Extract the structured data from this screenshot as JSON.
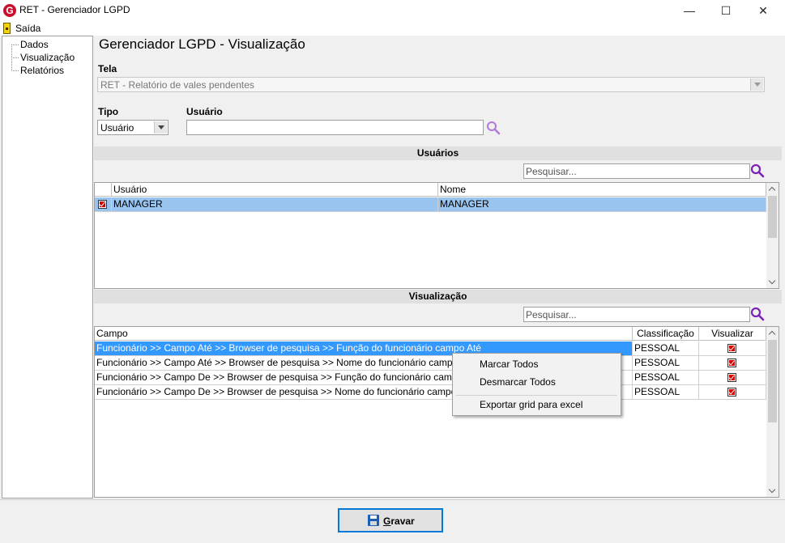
{
  "window": {
    "app_icon": "G",
    "title": "RET - Gerenciador LGPD",
    "minimize": "—",
    "maximize": "☐",
    "close": "✕"
  },
  "menu": {
    "exit_label": "Saída"
  },
  "tree": {
    "items": [
      "Dados",
      "Visualização",
      "Relatórios"
    ]
  },
  "page": {
    "title": "Gerenciador LGPD - Visualização"
  },
  "tela": {
    "label": "Tela",
    "value": "RET - Relatório de vales pendentes"
  },
  "tipo": {
    "label": "Tipo",
    "value": "Usuário"
  },
  "usuario_field": {
    "label": "Usuário",
    "value": ""
  },
  "usuarios_section": {
    "title": "Usuários",
    "search_placeholder": "Pesquisar...",
    "columns": [
      "Usuário",
      "Nome"
    ],
    "rows": [
      {
        "usuario": "MANAGER",
        "nome": "MANAGER",
        "checked": true
      }
    ]
  },
  "visualizacao_section": {
    "title": "Visualização",
    "search_placeholder": "Pesquisar...",
    "columns": [
      "Campo",
      "Classificação",
      "Visualizar"
    ],
    "rows": [
      {
        "campo": "Funcionário >> Campo Até >> Browser de pesquisa >> Função do funcionário campo Até",
        "classificacao": "PESSOAL",
        "visualizar": true
      },
      {
        "campo": "Funcionário >> Campo Até >> Browser de pesquisa >> Nome do funcionário campo Até",
        "classificacao": "PESSOAL",
        "visualizar": true
      },
      {
        "campo": "Funcionário >> Campo De >> Browser de pesquisa >> Função do funcionário campo De",
        "classificacao": "PESSOAL",
        "visualizar": true
      },
      {
        "campo": "Funcionário >> Campo De >> Browser de pesquisa >> Nome do funcionário campo De",
        "classificacao": "PESSOAL",
        "visualizar": true
      }
    ]
  },
  "context_menu": {
    "items": [
      "Marcar Todos",
      "Desmarcar Todos",
      "Exportar grid para excel"
    ]
  },
  "footer": {
    "save_label_first": "G",
    "save_label_rest": "ravar"
  },
  "colors": {
    "selection": "#3399ff",
    "accent": "#0078d7",
    "check": "#d40000",
    "search_icon": "#7a22b8"
  }
}
